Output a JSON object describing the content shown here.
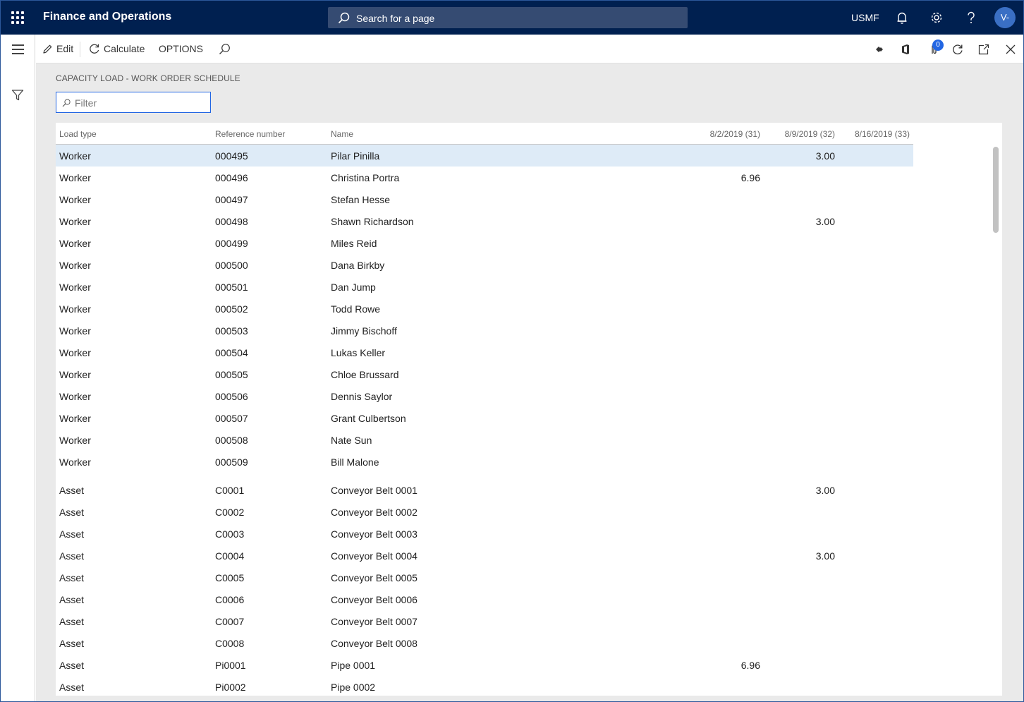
{
  "topbar": {
    "app_title": "Finance and Operations",
    "search_placeholder": "Search for a page",
    "company": "USMF",
    "avatar_initials": "V-",
    "icons": [
      "app-launcher-icon",
      "search-icon",
      "bell-icon",
      "gear-icon",
      "help-icon"
    ]
  },
  "actionpane": {
    "edit_label": "Edit",
    "calculate_label": "Calculate",
    "options_label": "OPTIONS",
    "attachments_count": "0",
    "icons": [
      "edit-icon",
      "refresh-icon",
      "search-icon",
      "diamond-icon",
      "office-icon",
      "paperclip-icon",
      "refresh-icon",
      "open-new-window-icon",
      "close-icon"
    ]
  },
  "page": {
    "title": "CAPACITY LOAD - WORK ORDER SCHEDULE",
    "filter_placeholder": "Filter"
  },
  "grid": {
    "columns": [
      "Load type",
      "Reference number",
      "Name",
      "8/2/2019 (31)",
      "8/9/2019 (32)",
      "8/16/2019 (33)"
    ],
    "rows": [
      {
        "type": "Worker",
        "ref": "000495",
        "name": "Pilar Pinilla",
        "w31": "",
        "w32": "3.00",
        "w33": ""
      },
      {
        "type": "Worker",
        "ref": "000496",
        "name": "Christina Portra",
        "w31": "6.96",
        "w32": "",
        "w33": ""
      },
      {
        "type": "Worker",
        "ref": "000497",
        "name": "Stefan Hesse",
        "w31": "",
        "w32": "",
        "w33": ""
      },
      {
        "type": "Worker",
        "ref": "000498",
        "name": "Shawn Richardson",
        "w31": "",
        "w32": "3.00",
        "w33": ""
      },
      {
        "type": "Worker",
        "ref": "000499",
        "name": "Miles Reid",
        "w31": "",
        "w32": "",
        "w33": ""
      },
      {
        "type": "Worker",
        "ref": "000500",
        "name": "Dana Birkby",
        "w31": "",
        "w32": "",
        "w33": ""
      },
      {
        "type": "Worker",
        "ref": "000501",
        "name": "Dan Jump",
        "w31": "",
        "w32": "",
        "w33": ""
      },
      {
        "type": "Worker",
        "ref": "000502",
        "name": "Todd Rowe",
        "w31": "",
        "w32": "",
        "w33": ""
      },
      {
        "type": "Worker",
        "ref": "000503",
        "name": "Jimmy Bischoff",
        "w31": "",
        "w32": "",
        "w33": ""
      },
      {
        "type": "Worker",
        "ref": "000504",
        "name": "Lukas Keller",
        "w31": "",
        "w32": "",
        "w33": ""
      },
      {
        "type": "Worker",
        "ref": "000505",
        "name": "Chloe Brussard",
        "w31": "",
        "w32": "",
        "w33": ""
      },
      {
        "type": "Worker",
        "ref": "000506",
        "name": "Dennis Saylor",
        "w31": "",
        "w32": "",
        "w33": ""
      },
      {
        "type": "Worker",
        "ref": "000507",
        "name": "Grant Culbertson",
        "w31": "",
        "w32": "",
        "w33": ""
      },
      {
        "type": "Worker",
        "ref": "000508",
        "name": "Nate Sun",
        "w31": "",
        "w32": "",
        "w33": ""
      },
      {
        "type": "Worker",
        "ref": "000509",
        "name": "Bill Malone",
        "w31": "",
        "w32": "",
        "w33": ""
      },
      {
        "type": "Asset",
        "ref": "C0001",
        "name": "Conveyor Belt 0001",
        "w31": "",
        "w32": "3.00",
        "w33": ""
      },
      {
        "type": "Asset",
        "ref": "C0002",
        "name": "Conveyor Belt 0002",
        "w31": "",
        "w32": "",
        "w33": ""
      },
      {
        "type": "Asset",
        "ref": "C0003",
        "name": "Conveyor Belt 0003",
        "w31": "",
        "w32": "",
        "w33": ""
      },
      {
        "type": "Asset",
        "ref": "C0004",
        "name": "Conveyor Belt 0004",
        "w31": "",
        "w32": "3.00",
        "w33": ""
      },
      {
        "type": "Asset",
        "ref": "C0005",
        "name": "Conveyor Belt 0005",
        "w31": "",
        "w32": "",
        "w33": ""
      },
      {
        "type": "Asset",
        "ref": "C0006",
        "name": "Conveyor Belt 0006",
        "w31": "",
        "w32": "",
        "w33": ""
      },
      {
        "type": "Asset",
        "ref": "C0007",
        "name": "Conveyor Belt 0007",
        "w31": "",
        "w32": "",
        "w33": ""
      },
      {
        "type": "Asset",
        "ref": "C0008",
        "name": "Conveyor Belt 0008",
        "w31": "",
        "w32": "",
        "w33": ""
      },
      {
        "type": "Asset",
        "ref": "Pi0001",
        "name": "Pipe 0001",
        "w31": "6.96",
        "w32": "",
        "w33": ""
      },
      {
        "type": "Asset",
        "ref": "Pi0002",
        "name": "Pipe 0002",
        "w31": "",
        "w32": "",
        "w33": ""
      }
    ]
  }
}
